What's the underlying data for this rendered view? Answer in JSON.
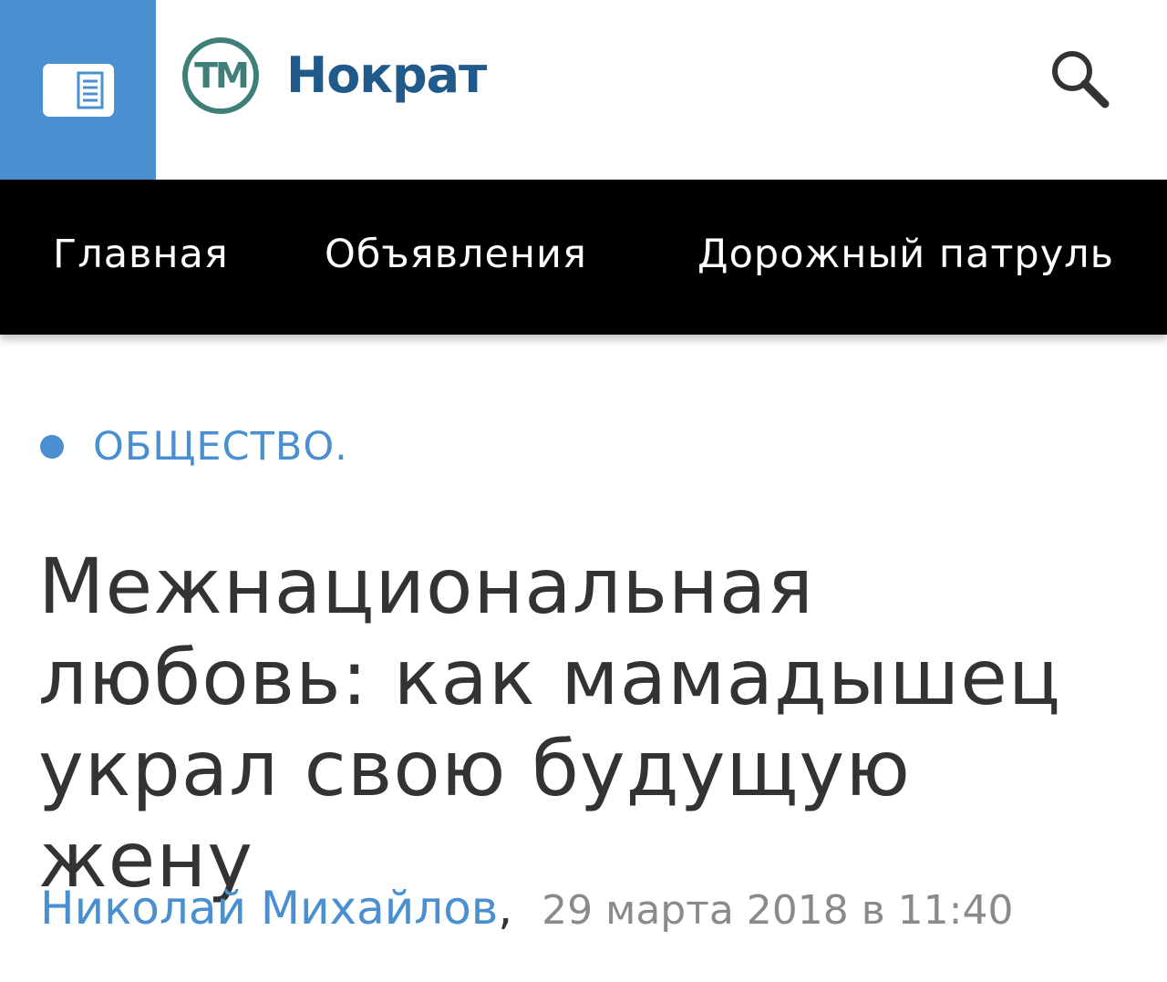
{
  "header": {
    "menu_icon": "newspaper-menu-icon",
    "logo_mark_text": "ТМ",
    "logo_text": "Нократ",
    "search_icon": "search-icon"
  },
  "nav": {
    "items": [
      {
        "label": "Главная"
      },
      {
        "label": "Объявления"
      },
      {
        "label": "Дорожный патруль"
      }
    ]
  },
  "article": {
    "category": "ОБЩЕСТВО.",
    "headline_lines": [
      "Межнациональная",
      "любовь: как мамадышец",
      "украл свою будущую жену"
    ],
    "author": "Николай Михайлов",
    "separator": ",",
    "date": "29 марта 2018 в 11:40"
  },
  "colors": {
    "brand_blue": "#4a8fcf",
    "logo_dark_blue": "#1f5a8b",
    "logo_teal": "#3f7f7a",
    "nav_background": "#000000",
    "headline_text": "#333333",
    "date_gray": "#8a8a8a"
  }
}
